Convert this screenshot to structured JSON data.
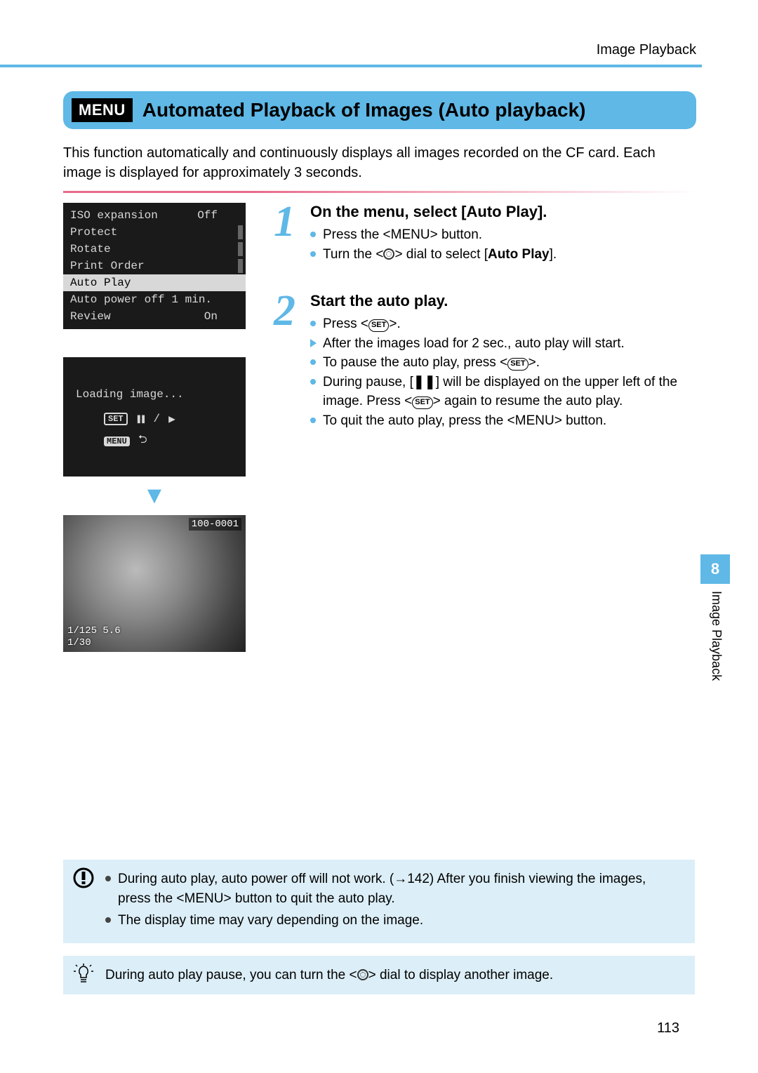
{
  "header": {
    "breadcrumb": "Image Playback"
  },
  "title": {
    "badge": "MENU",
    "text": "Automated Playback of Images (Auto playback)"
  },
  "intro": "This function automatically and continuously displays all images recorded on the CF card. Each image is displayed for approximately 3 seconds.",
  "camera_menu": {
    "rows": [
      {
        "label": "ISO expansion",
        "value": "Off"
      },
      {
        "label": "Protect",
        "value": ""
      },
      {
        "label": "Rotate",
        "value": ""
      },
      {
        "label": "Print Order",
        "value": ""
      },
      {
        "label": "Auto Play",
        "value": "",
        "selected": true
      },
      {
        "label": "Auto power off",
        "value": "1 min."
      },
      {
        "label": "Review",
        "value": "On"
      }
    ]
  },
  "loading": {
    "text": "Loading image...",
    "set_label": "SET",
    "menu_label": "MENU"
  },
  "photo_overlay": {
    "file_number": "100-0001",
    "line1": "1/125  5.6",
    "line2": "1/30"
  },
  "steps": [
    {
      "num": "1",
      "heading": "On the menu, select [Auto Play].",
      "bullets": [
        {
          "type": "dot",
          "pre": "Press the <",
          "icon": "MENU",
          "post": "> button."
        },
        {
          "type": "dot",
          "pre": "Turn the <",
          "icon": "DIAL",
          "post": "> dial to select [",
          "bold": "Auto Play",
          "tail": "]."
        }
      ]
    },
    {
      "num": "2",
      "heading": "Start the auto play.",
      "bullets": [
        {
          "type": "dot",
          "pre": "Press <",
          "icon": "SET",
          "post": ">."
        },
        {
          "type": "arrow",
          "text": "After the images load for 2 sec., auto play will start."
        },
        {
          "type": "dot",
          "pre": "To pause the auto play, press <",
          "icon": "SET",
          "post": ">."
        },
        {
          "type": "dot",
          "pre": "During pause, [",
          "icon": "PAUSE",
          "post": "] will be displayed on the upper left of the image. Press <",
          "icon2": "SET",
          "post2": "> again to resume the auto play."
        },
        {
          "type": "dot",
          "pre": "To quit the auto play, press the <",
          "icon": "MENU",
          "post": "> button."
        }
      ]
    }
  ],
  "side_tab": {
    "chapter_number": "8",
    "chapter_title": "Image Playback"
  },
  "notes": {
    "caution": [
      "During auto play, auto power off will not work. (→142) After you finish viewing the images, press the <MENU> button to quit the auto play.",
      "The display time may vary depending on the image."
    ],
    "tip": "During auto play pause, you can turn the <DIAL> dial to display another image."
  },
  "page_number": "113"
}
